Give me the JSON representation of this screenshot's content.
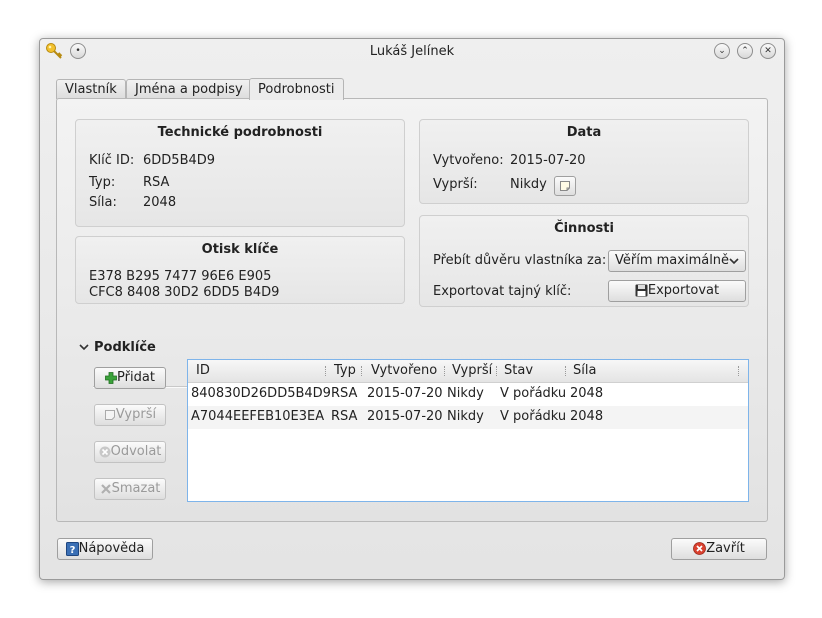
{
  "window": {
    "title": "Lukáš Jelínek"
  },
  "tabs": [
    "Vlastník",
    "Jména a podpisy",
    "Podrobnosti"
  ],
  "technical": {
    "title": "Technické podrobnosti",
    "key_id_label": "Klíč ID:",
    "key_id": "6DD5B4D9",
    "type_label": "Typ:",
    "type": "RSA",
    "strength_label": "Síla:",
    "strength": "2048"
  },
  "fingerprint": {
    "title": "Otisk klíče",
    "line1": "E378 B295 7477 96E6 E905",
    "line2": "CFC8 8408 30D2 6DD5 B4D9"
  },
  "dates": {
    "title": "Data",
    "created_label": "Vytvořeno:",
    "created": "2015-07-20",
    "expires_label": "Vyprší:",
    "expires": "Nikdy"
  },
  "actions": {
    "title": "Činnosti",
    "trust_label": "Přebít důvěru vlastníka za:",
    "trust_value": "Věřím maximálně",
    "export_label": "Exportovat tajný klíč:",
    "export_button": "Exportovat"
  },
  "subkeys": {
    "title": "Podklíče",
    "buttons": {
      "add": "Přidat",
      "expire": "Vyprší",
      "revoke": "Odvolat",
      "delete": "Smazat"
    },
    "columns": [
      "ID",
      "Typ",
      "Vytvořeno",
      "Vyprší",
      "Stav",
      "Síla"
    ],
    "rows": [
      [
        "840830D26DD5B4D9",
        "RSA",
        "2015-07-20",
        "Nikdy",
        "V pořádku",
        "2048"
      ],
      [
        "A7044EEFEB10E3EA",
        "RSA",
        "2015-07-20",
        "Nikdy",
        "V pořádku",
        "2048"
      ]
    ]
  },
  "footer": {
    "help": "Nápověda",
    "close": "Zavřít"
  },
  "colors": {
    "list_border": "#7eb4ea",
    "alt_row": "#f4f4f4",
    "close_icon": "#d9402e",
    "add_icon": "#3aa23a"
  }
}
